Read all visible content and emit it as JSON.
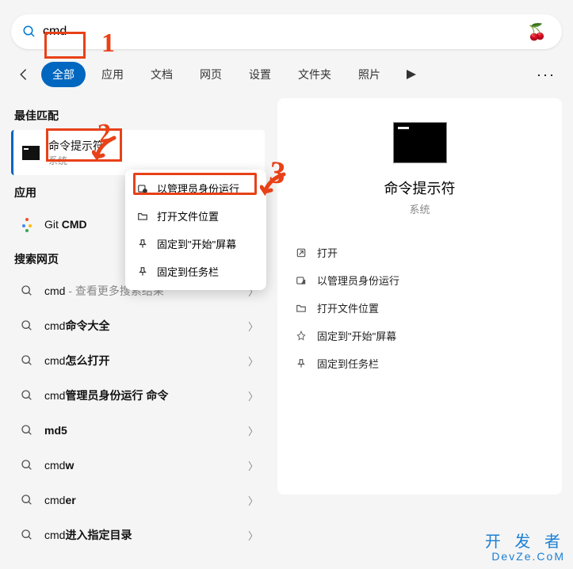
{
  "search": {
    "value": "cmd"
  },
  "tabs": [
    "全部",
    "应用",
    "文档",
    "网页",
    "设置",
    "文件夹",
    "照片"
  ],
  "sections": {
    "best_match": "最佳匹配",
    "apps": "应用",
    "web": "搜索网页"
  },
  "best": {
    "title": "命令提示符",
    "sub": "系统"
  },
  "apps": [
    {
      "prefix": "Git ",
      "bold": "CMD"
    }
  ],
  "web_results": [
    {
      "text": "cmd",
      "suffix": " - 查看更多搜索结果"
    },
    {
      "text_pre": "cmd",
      "text_post": "命令大全"
    },
    {
      "text_pre": "cmd",
      "text_post": "怎么打开"
    },
    {
      "text_pre": "cmd",
      "text_post": "管理员身份运行 命令"
    },
    {
      "text_pre": "",
      "text_post": "md5"
    },
    {
      "text_pre": "cmd",
      "text_post": "w"
    },
    {
      "text_pre": "cmd",
      "text_post": "er"
    },
    {
      "text_pre": "cmd",
      "text_post": "进入指定目录"
    }
  ],
  "context_menu": [
    "以管理员身份运行",
    "打开文件位置",
    "固定到\"开始\"屏幕",
    "固定到任务栏"
  ],
  "preview": {
    "title": "命令提示符",
    "sub": "系统",
    "actions": [
      "打开",
      "以管理员身份运行",
      "打开文件位置",
      "固定到\"开始\"屏幕",
      "固定到任务栏"
    ]
  },
  "annotations": {
    "a1": "1",
    "a2": "2",
    "a3": "3"
  },
  "watermark": {
    "line1": "开 发 者",
    "line2": "DevZe.CoM"
  }
}
